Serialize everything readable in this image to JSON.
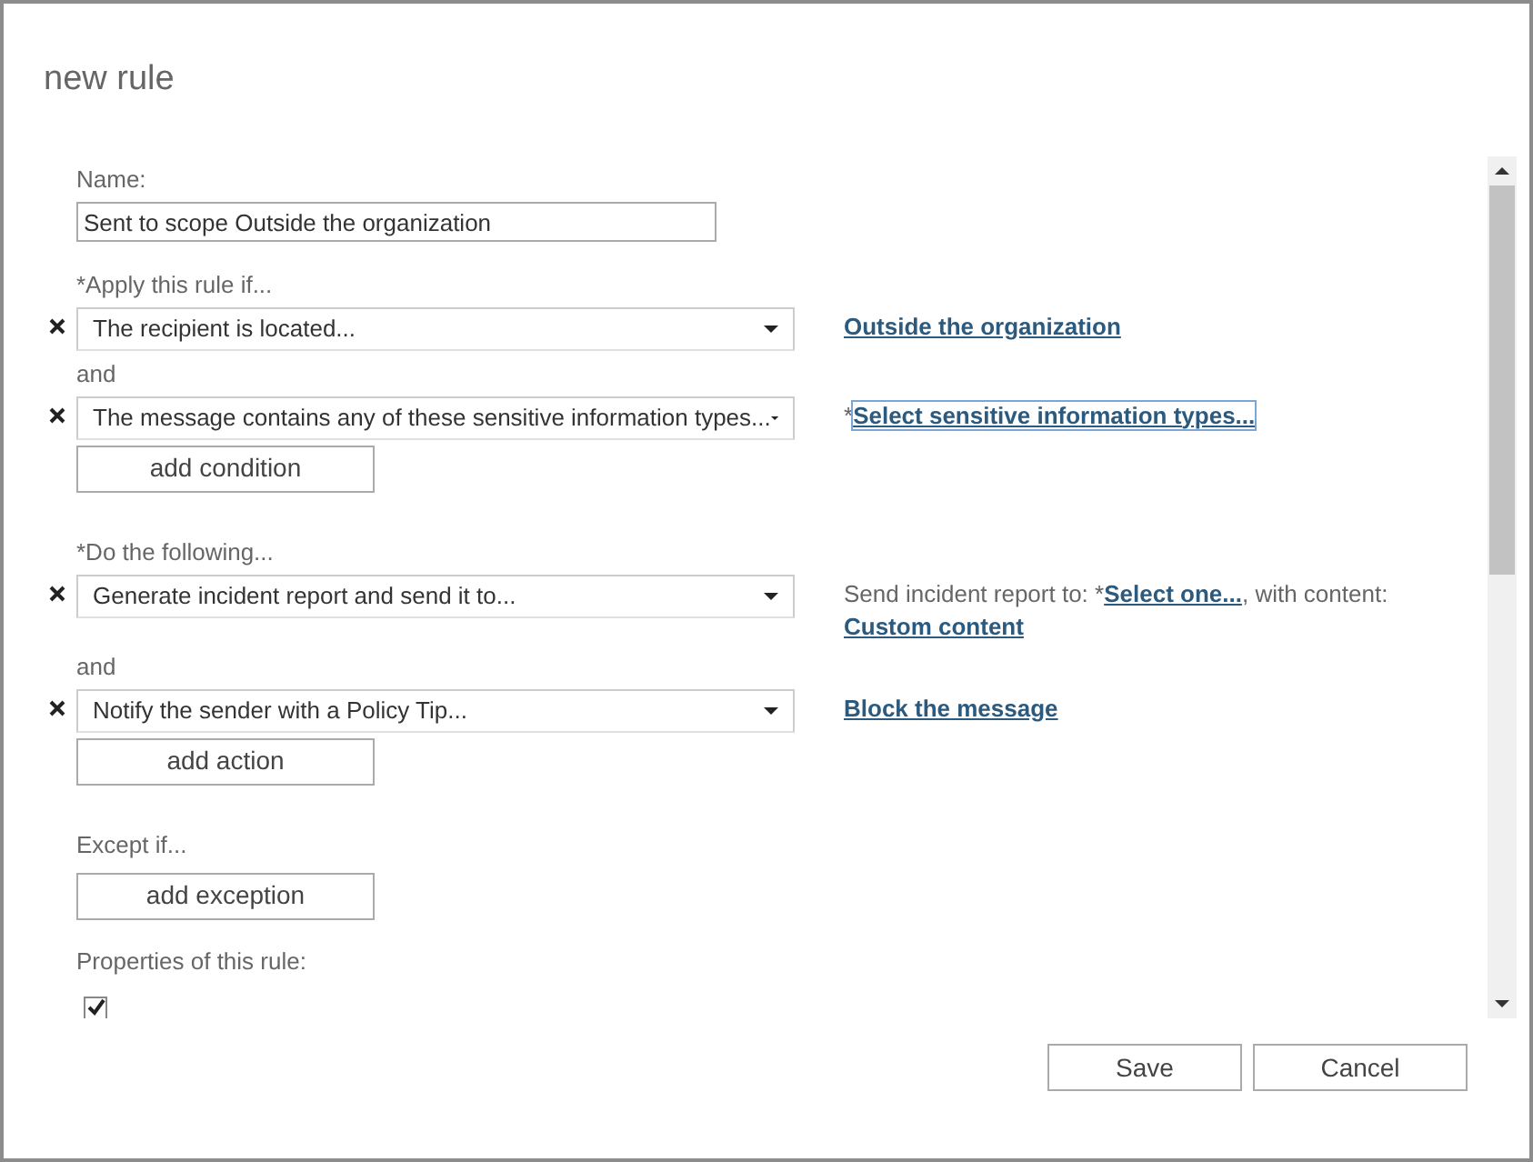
{
  "window": {
    "title": "new rule"
  },
  "name_field": {
    "label": "Name:",
    "value": "Sent to scope Outside the organization"
  },
  "sections": [
    {
      "label": "*Apply this rule if...",
      "connector": "and",
      "add_button": "add condition",
      "rows": [
        {
          "value": "The recipient is located...",
          "detail": [
            {
              "kind": "link",
              "text": "Outside the organization",
              "focused": false
            }
          ]
        },
        {
          "value": "The message contains any of these sensitive information types...",
          "detail": [
            {
              "kind": "text",
              "text": "*"
            },
            {
              "kind": "link",
              "text": "Select sensitive information types...",
              "focused": true
            }
          ]
        }
      ]
    },
    {
      "label": "*Do the following...",
      "connector": "and",
      "add_button": "add action",
      "rows": [
        {
          "value": "Generate incident report and send it to...",
          "detail": [
            {
              "kind": "text",
              "text": "Send incident report to: *"
            },
            {
              "kind": "link",
              "text": "Select one...",
              "focused": false
            },
            {
              "kind": "text",
              "text": ", with content: "
            },
            {
              "kind": "link",
              "text": "Custom content",
              "focused": false
            }
          ]
        },
        {
          "value": "Notify the sender with a Policy Tip...",
          "detail": [
            {
              "kind": "link",
              "text": "Block the message",
              "focused": false
            }
          ]
        }
      ]
    },
    {
      "label": "Except if...",
      "add_button": "add exception"
    }
  ],
  "properties": {
    "label": "Properties of this rule:",
    "checkbox": {
      "checked": true
    }
  },
  "buttons": [
    "Save",
    "Cancel"
  ]
}
